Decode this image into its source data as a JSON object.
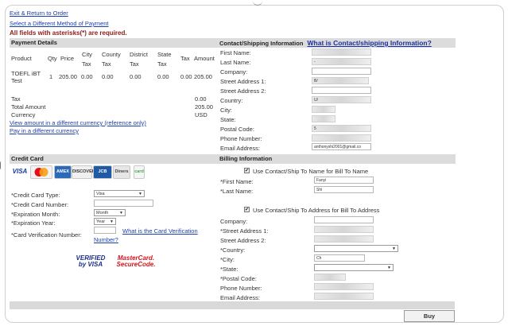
{
  "top_links": {
    "exit": "Exit & Return to Order",
    "different_method": "Select a Different Method of Payment"
  },
  "required_note": "All fields with asterisks(*) are required.",
  "payment_details": {
    "header": "Payment Details",
    "columns": [
      "Product",
      "Qty",
      "Price",
      "City Tax",
      "County Tax",
      "District Tax",
      "State Tax",
      "Tax",
      "Amount"
    ],
    "row": {
      "product": "TOEFL iBT Test",
      "qty": "1",
      "price": "205.00",
      "city": "0.00",
      "county": "0.00",
      "district": "0.00",
      "state": "0.00",
      "tax": "0.00",
      "amount": "205.00"
    },
    "summary": [
      {
        "label": "Tax",
        "value": "0.00"
      },
      {
        "label": "Total Amount",
        "value": "205.00"
      },
      {
        "label": "Currency",
        "value": "USD"
      }
    ],
    "link_other_currency": "View amount in a different currency (reference only)",
    "link_pay_other_currency": "Pay in a different currency"
  },
  "contact": {
    "header": "Contact/Shipping Information",
    "help_link": "What is Contact/shipping Information?",
    "fields": [
      {
        "label": "First Name:",
        "value": ""
      },
      {
        "label": "Last Name:",
        "value": "-"
      },
      {
        "label": "Company:",
        "value": ""
      },
      {
        "label": "Street Address 1:",
        "value": "B/"
      },
      {
        "label": "Street Address 2:",
        "value": ""
      },
      {
        "label": "Country:",
        "value": "U/"
      },
      {
        "label": "City:",
        "value": ""
      },
      {
        "label": "State:",
        "value": ""
      },
      {
        "label": "Postal Code:",
        "value": "5"
      },
      {
        "label": "Phone Number:",
        "value": ""
      },
      {
        "label": "Email Address:",
        "value": "anthonyshi2001@gmail.co"
      }
    ]
  },
  "credit_card": {
    "header": "Credit Card",
    "logos": [
      "VISA",
      "MC",
      "AMEX",
      "DISCOVER",
      "JCB",
      "Diners",
      "card"
    ],
    "labels": {
      "type": "*Credit Card Type:",
      "number": "*Credit Card Number:",
      "month": "*Expiration Month:",
      "year": "*Expiration Year:",
      "cvn": "*Card Verification Number:"
    },
    "type_value": "Visa",
    "month_value": "Month",
    "year_value": "Year",
    "cvn_help": "What is the Card Verification Number?",
    "verified_visa": "VERIFIED by VISA",
    "mastercard": "MasterCard. SecureCode."
  },
  "billing": {
    "header": "Billing Information",
    "use_name_label": "Use Contact/Ship To Name for Bill To Name",
    "first_name_label": "*First Name:",
    "first_name_value": "Fanyi",
    "last_name_label": "*Last Name:",
    "last_name_value": "Shi",
    "use_address_label": "Use Contact/Ship To Address for Bill To Address",
    "fields": [
      {
        "label": "Company:",
        "value": ""
      },
      {
        "label": "*Street Address 1:",
        "value": ""
      },
      {
        "label": "Street Address 2:",
        "value": ""
      },
      {
        "label": "*Country:",
        "value": ""
      },
      {
        "label": "*City:",
        "value": "Ch"
      },
      {
        "label": "*State:",
        "value": ""
      },
      {
        "label": "*Postal Code:",
        "value": ""
      },
      {
        "label": "Phone Number:",
        "value": ""
      },
      {
        "label": "Email Address:",
        "value": ""
      }
    ]
  },
  "buy_button": "Buy"
}
